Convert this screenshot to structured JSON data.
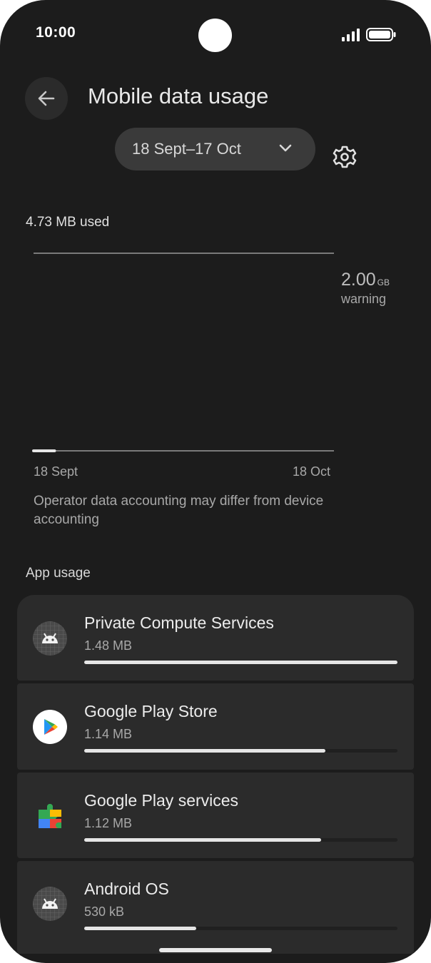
{
  "status_bar": {
    "time": "10:00"
  },
  "header": {
    "title": "Mobile data usage"
  },
  "cycle": {
    "label": "18 Sept–17 Oct"
  },
  "usage": {
    "used": "4.73 MB used",
    "warning_value": "2.00",
    "warning_unit": "GB",
    "warning_label": "warning",
    "start_date": "18 Sept",
    "end_date": "18 Oct",
    "used_fraction_of_period": 0.07,
    "note": "Operator data accounting may differ from device accounting"
  },
  "app_usage": {
    "heading": "App usage",
    "apps": [
      {
        "name": "Private Compute Services",
        "size": "1.48 MB",
        "fraction": 1.0,
        "icon": "android-icon"
      },
      {
        "name": "Google Play Store",
        "size": "1.14 MB",
        "fraction": 0.77,
        "icon": "play-store-icon"
      },
      {
        "name": "Google Play services",
        "size": "1.12 MB",
        "fraction": 0.757,
        "icon": "play-services-icon"
      },
      {
        "name": "Android OS",
        "size": "530 kB",
        "fraction": 0.358,
        "icon": "android-icon"
      }
    ]
  },
  "colors": {
    "background": "#1c1c1c",
    "card": "#2b2b2b",
    "bar": "#e6e6e6",
    "text": "#e8e8e8"
  }
}
